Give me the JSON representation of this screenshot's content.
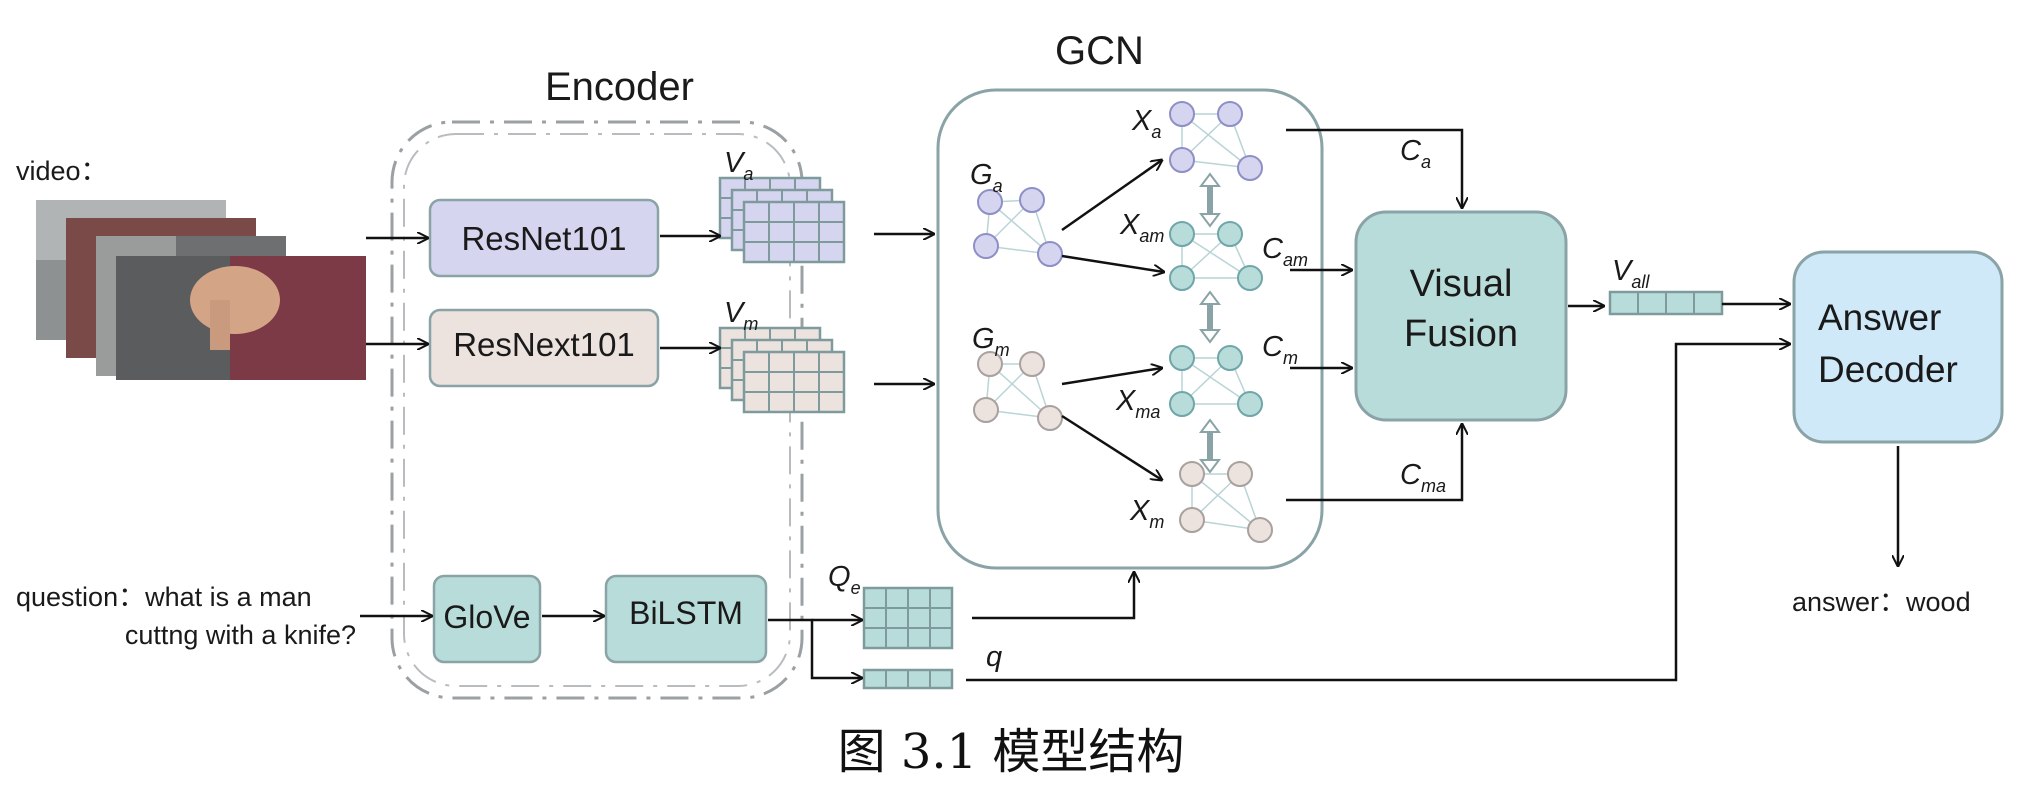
{
  "labels": {
    "encoder": "Encoder",
    "gcn": "GCN",
    "video": "video：",
    "question_line1": "question：what is a man",
    "question_line2": "cuttng with a knife?",
    "answer": "answer：wood"
  },
  "boxes": {
    "resnet": "ResNet101",
    "resnext": "ResNext101",
    "glove": "GloVe",
    "bilstm": "BiLSTM",
    "fusion_line1": "Visual",
    "fusion_line2": "Fusion",
    "decoder_line1": "Answer",
    "decoder_line2": "Decoder"
  },
  "symbols": {
    "va": {
      "base": "V",
      "sub": "a"
    },
    "vm": {
      "base": "V",
      "sub": "m"
    },
    "ga": {
      "base": "G",
      "sub": "a"
    },
    "gm": {
      "base": "G",
      "sub": "m"
    },
    "xa": {
      "base": "X",
      "sub": "a"
    },
    "xam": {
      "base": "X",
      "sub": "am"
    },
    "xma": {
      "base": "X",
      "sub": "ma"
    },
    "xm": {
      "base": "X",
      "sub": "m"
    },
    "ca": {
      "base": "C",
      "sub": "a"
    },
    "cam": {
      "base": "C",
      "sub": "am"
    },
    "cm": {
      "base": "C",
      "sub": "m"
    },
    "cma": {
      "base": "C",
      "sub": "ma"
    },
    "vall": {
      "base": "V",
      "sub": "all"
    },
    "qe": {
      "base": "Q",
      "sub": "e"
    },
    "q": {
      "base": "q",
      "sub": ""
    }
  },
  "caption": "图 3.1   模型结构",
  "colors": {
    "purple_fill": "#d6d5f0",
    "beige_fill": "#ece2de",
    "teal_fill": "#b8dcd9",
    "blue_fill": "#cfe9f8",
    "box_stroke": "#8aa3a6",
    "line": "#111111"
  }
}
